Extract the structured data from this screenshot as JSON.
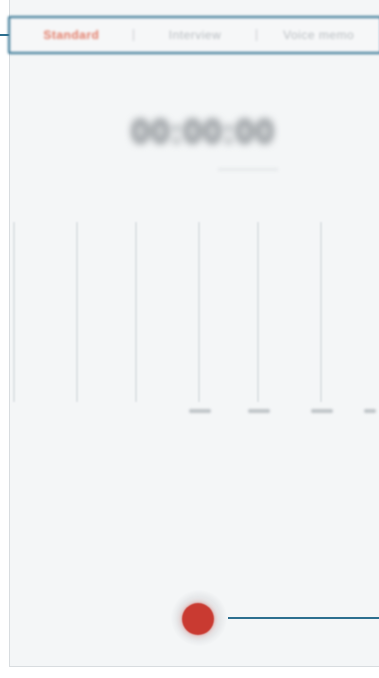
{
  "tabs": [
    {
      "label": "Standard",
      "active": true
    },
    {
      "label": "Interview",
      "active": false
    },
    {
      "label": "Voice memo",
      "active": false
    }
  ],
  "timer": "00:00:00",
  "colors": {
    "accent": "#e27a66",
    "record": "#c93a31",
    "callout": "#2c6f8f",
    "background": "#f4f6f7"
  },
  "icons": {
    "record": "record-dot-icon"
  }
}
